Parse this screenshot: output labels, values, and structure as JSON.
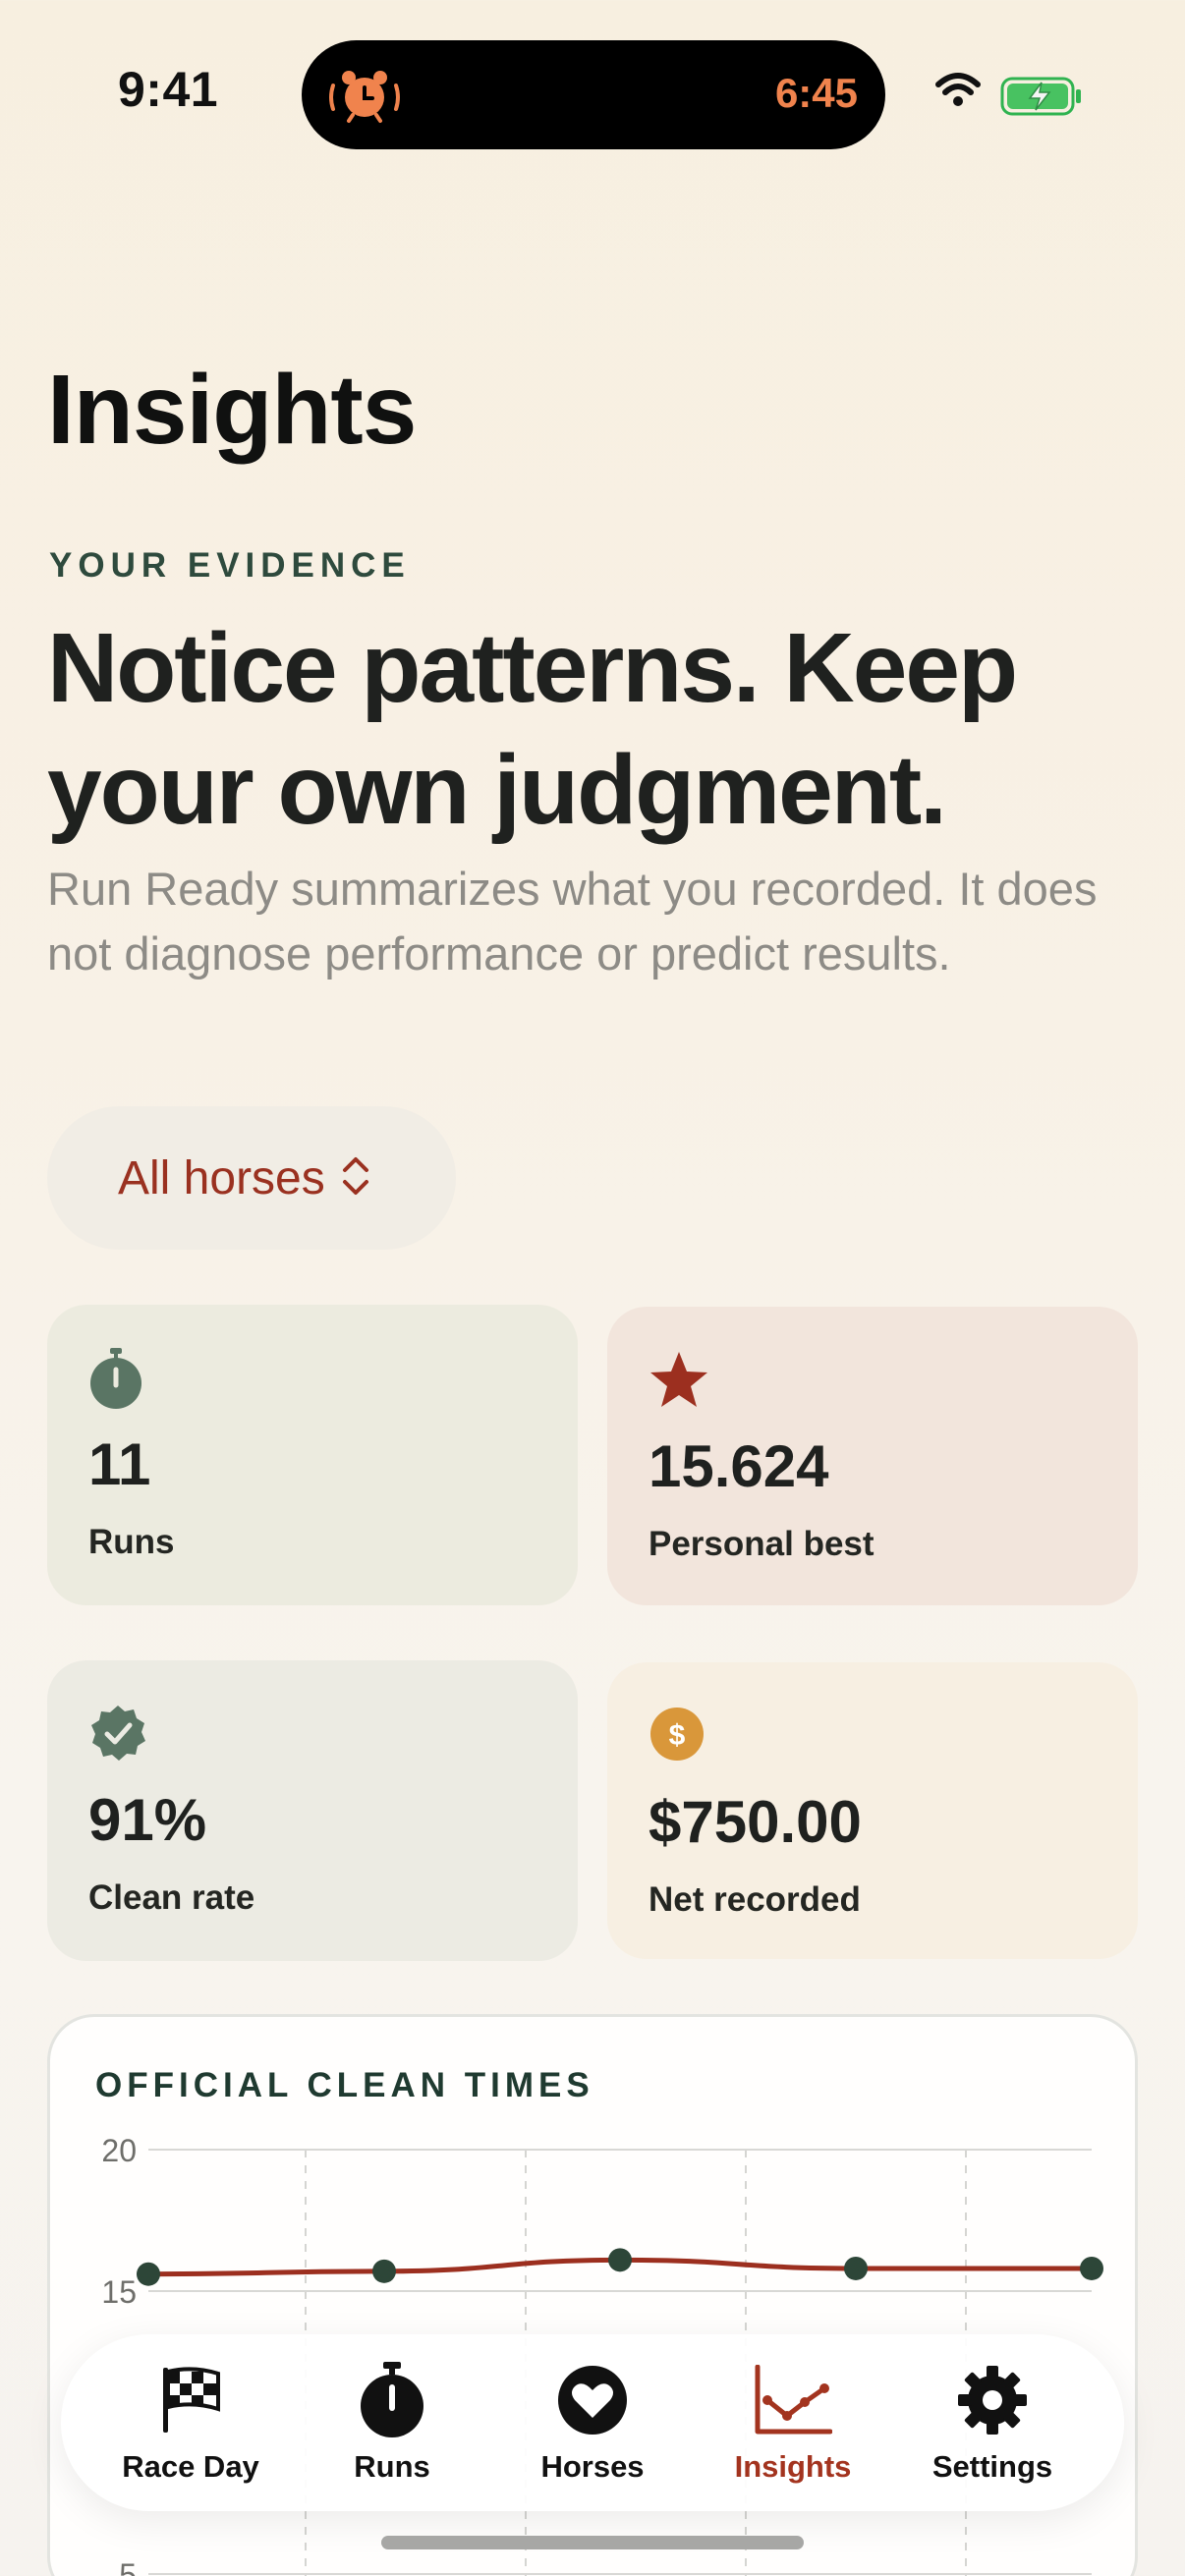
{
  "status_bar": {
    "time": "9:41",
    "alarm_time": "6:45"
  },
  "header": {
    "title": "Insights",
    "eyebrow": "YOUR EVIDENCE",
    "headline": "Notice patterns. Keep your own judgment.",
    "lede": "Run Ready summarizes what you recorded. It does not diagnose performance or predict results."
  },
  "filter": {
    "label": "All horses"
  },
  "stats": {
    "runs": {
      "value": "11",
      "caption": "Runs",
      "icon": "stopwatch-icon"
    },
    "best": {
      "value": "15.624",
      "caption": "Personal best",
      "icon": "star-icon"
    },
    "clean": {
      "value": "91%",
      "caption": "Clean rate",
      "icon": "checkmark-seal-icon"
    },
    "net": {
      "value": "$750.00",
      "caption": "Net recorded",
      "icon": "dollar-circle-icon"
    }
  },
  "colors": {
    "accent": "#9a3120",
    "green": "#5a7564",
    "gold": "#d9973a",
    "line": "#9c2f1f"
  },
  "chart_data": {
    "type": "line",
    "title": "OFFICIAL CLEAN TIMES",
    "yticks": [
      20,
      15,
      5
    ],
    "ylim": [
      0,
      20
    ],
    "grid": true,
    "series": [
      {
        "values": [
          15.6,
          15.7,
          16.1,
          15.8,
          15.8
        ]
      }
    ]
  },
  "tabs": [
    {
      "label": "Race Day",
      "icon": "checkered-flag-icon",
      "active": false
    },
    {
      "label": "Runs",
      "icon": "stopwatch-icon",
      "active": false
    },
    {
      "label": "Horses",
      "icon": "heart-icon",
      "active": false
    },
    {
      "label": "Insights",
      "icon": "chart-line-icon",
      "active": true
    },
    {
      "label": "Settings",
      "icon": "gear-icon",
      "active": false
    }
  ]
}
